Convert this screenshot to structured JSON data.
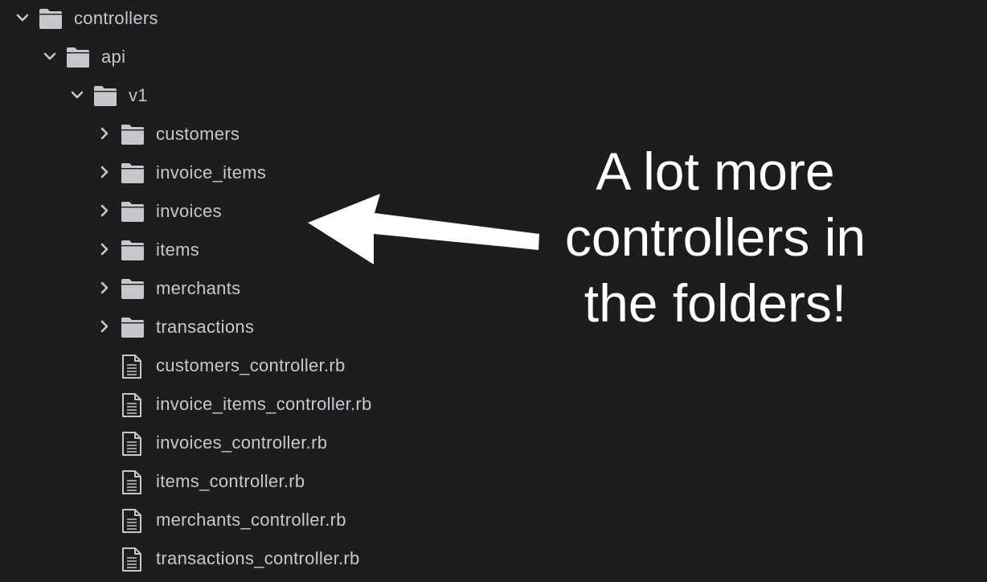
{
  "tree": {
    "items": [
      {
        "label": "controllers",
        "kind": "folder",
        "expanded": true,
        "depth": 0
      },
      {
        "label": "api",
        "kind": "folder",
        "expanded": true,
        "depth": 1
      },
      {
        "label": "v1",
        "kind": "folder",
        "expanded": true,
        "depth": 2
      },
      {
        "label": "customers",
        "kind": "folder",
        "expanded": false,
        "depth": 3
      },
      {
        "label": "invoice_items",
        "kind": "folder",
        "expanded": false,
        "depth": 3
      },
      {
        "label": "invoices",
        "kind": "folder",
        "expanded": false,
        "depth": 3
      },
      {
        "label": "items",
        "kind": "folder",
        "expanded": false,
        "depth": 3
      },
      {
        "label": "merchants",
        "kind": "folder",
        "expanded": false,
        "depth": 3
      },
      {
        "label": "transactions",
        "kind": "folder",
        "expanded": false,
        "depth": 3
      },
      {
        "label": "customers_controller.rb",
        "kind": "file",
        "depth": 3
      },
      {
        "label": "invoice_items_controller.rb",
        "kind": "file",
        "depth": 3
      },
      {
        "label": "invoices_controller.rb",
        "kind": "file",
        "depth": 3
      },
      {
        "label": "items_controller.rb",
        "kind": "file",
        "depth": 3
      },
      {
        "label": "merchants_controller.rb",
        "kind": "file",
        "depth": 3
      },
      {
        "label": "transactions_controller.rb",
        "kind": "file",
        "depth": 3
      }
    ]
  },
  "annotation": {
    "lines": [
      "A lot more",
      "controllers in",
      "the folders!"
    ]
  },
  "icons": {
    "folder": "folder-icon",
    "file": "file-icon",
    "expanded": "chevron-down-icon",
    "collapsed": "chevron-right-icon",
    "arrow": "arrow-left-icon"
  },
  "colors": {
    "background": "#1d1d1f",
    "text": "#c8c8cc",
    "icon": "#c8c8cc",
    "annotation": "#ffffff"
  }
}
